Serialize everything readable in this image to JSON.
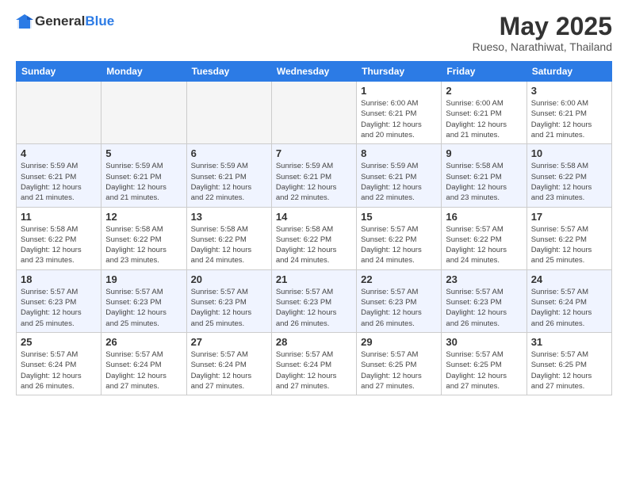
{
  "logo": {
    "general": "General",
    "blue": "Blue"
  },
  "header": {
    "month": "May 2025",
    "location": "Rueso, Narathiwat, Thailand"
  },
  "weekdays": [
    "Sunday",
    "Monday",
    "Tuesday",
    "Wednesday",
    "Thursday",
    "Friday",
    "Saturday"
  ],
  "weeks": [
    {
      "shade": false,
      "days": [
        {
          "num": "",
          "info": ""
        },
        {
          "num": "",
          "info": ""
        },
        {
          "num": "",
          "info": ""
        },
        {
          "num": "",
          "info": ""
        },
        {
          "num": "1",
          "info": "Sunrise: 6:00 AM\nSunset: 6:21 PM\nDaylight: 12 hours\nand 20 minutes."
        },
        {
          "num": "2",
          "info": "Sunrise: 6:00 AM\nSunset: 6:21 PM\nDaylight: 12 hours\nand 21 minutes."
        },
        {
          "num": "3",
          "info": "Sunrise: 6:00 AM\nSunset: 6:21 PM\nDaylight: 12 hours\nand 21 minutes."
        }
      ]
    },
    {
      "shade": true,
      "days": [
        {
          "num": "4",
          "info": "Sunrise: 5:59 AM\nSunset: 6:21 PM\nDaylight: 12 hours\nand 21 minutes."
        },
        {
          "num": "5",
          "info": "Sunrise: 5:59 AM\nSunset: 6:21 PM\nDaylight: 12 hours\nand 21 minutes."
        },
        {
          "num": "6",
          "info": "Sunrise: 5:59 AM\nSunset: 6:21 PM\nDaylight: 12 hours\nand 22 minutes."
        },
        {
          "num": "7",
          "info": "Sunrise: 5:59 AM\nSunset: 6:21 PM\nDaylight: 12 hours\nand 22 minutes."
        },
        {
          "num": "8",
          "info": "Sunrise: 5:59 AM\nSunset: 6:21 PM\nDaylight: 12 hours\nand 22 minutes."
        },
        {
          "num": "9",
          "info": "Sunrise: 5:58 AM\nSunset: 6:21 PM\nDaylight: 12 hours\nand 23 minutes."
        },
        {
          "num": "10",
          "info": "Sunrise: 5:58 AM\nSunset: 6:22 PM\nDaylight: 12 hours\nand 23 minutes."
        }
      ]
    },
    {
      "shade": false,
      "days": [
        {
          "num": "11",
          "info": "Sunrise: 5:58 AM\nSunset: 6:22 PM\nDaylight: 12 hours\nand 23 minutes."
        },
        {
          "num": "12",
          "info": "Sunrise: 5:58 AM\nSunset: 6:22 PM\nDaylight: 12 hours\nand 23 minutes."
        },
        {
          "num": "13",
          "info": "Sunrise: 5:58 AM\nSunset: 6:22 PM\nDaylight: 12 hours\nand 24 minutes."
        },
        {
          "num": "14",
          "info": "Sunrise: 5:58 AM\nSunset: 6:22 PM\nDaylight: 12 hours\nand 24 minutes."
        },
        {
          "num": "15",
          "info": "Sunrise: 5:57 AM\nSunset: 6:22 PM\nDaylight: 12 hours\nand 24 minutes."
        },
        {
          "num": "16",
          "info": "Sunrise: 5:57 AM\nSunset: 6:22 PM\nDaylight: 12 hours\nand 24 minutes."
        },
        {
          "num": "17",
          "info": "Sunrise: 5:57 AM\nSunset: 6:22 PM\nDaylight: 12 hours\nand 25 minutes."
        }
      ]
    },
    {
      "shade": true,
      "days": [
        {
          "num": "18",
          "info": "Sunrise: 5:57 AM\nSunset: 6:23 PM\nDaylight: 12 hours\nand 25 minutes."
        },
        {
          "num": "19",
          "info": "Sunrise: 5:57 AM\nSunset: 6:23 PM\nDaylight: 12 hours\nand 25 minutes."
        },
        {
          "num": "20",
          "info": "Sunrise: 5:57 AM\nSunset: 6:23 PM\nDaylight: 12 hours\nand 25 minutes."
        },
        {
          "num": "21",
          "info": "Sunrise: 5:57 AM\nSunset: 6:23 PM\nDaylight: 12 hours\nand 26 minutes."
        },
        {
          "num": "22",
          "info": "Sunrise: 5:57 AM\nSunset: 6:23 PM\nDaylight: 12 hours\nand 26 minutes."
        },
        {
          "num": "23",
          "info": "Sunrise: 5:57 AM\nSunset: 6:23 PM\nDaylight: 12 hours\nand 26 minutes."
        },
        {
          "num": "24",
          "info": "Sunrise: 5:57 AM\nSunset: 6:24 PM\nDaylight: 12 hours\nand 26 minutes."
        }
      ]
    },
    {
      "shade": false,
      "days": [
        {
          "num": "25",
          "info": "Sunrise: 5:57 AM\nSunset: 6:24 PM\nDaylight: 12 hours\nand 26 minutes."
        },
        {
          "num": "26",
          "info": "Sunrise: 5:57 AM\nSunset: 6:24 PM\nDaylight: 12 hours\nand 27 minutes."
        },
        {
          "num": "27",
          "info": "Sunrise: 5:57 AM\nSunset: 6:24 PM\nDaylight: 12 hours\nand 27 minutes."
        },
        {
          "num": "28",
          "info": "Sunrise: 5:57 AM\nSunset: 6:24 PM\nDaylight: 12 hours\nand 27 minutes."
        },
        {
          "num": "29",
          "info": "Sunrise: 5:57 AM\nSunset: 6:25 PM\nDaylight: 12 hours\nand 27 minutes."
        },
        {
          "num": "30",
          "info": "Sunrise: 5:57 AM\nSunset: 6:25 PM\nDaylight: 12 hours\nand 27 minutes."
        },
        {
          "num": "31",
          "info": "Sunrise: 5:57 AM\nSunset: 6:25 PM\nDaylight: 12 hours\nand 27 minutes."
        }
      ]
    }
  ]
}
